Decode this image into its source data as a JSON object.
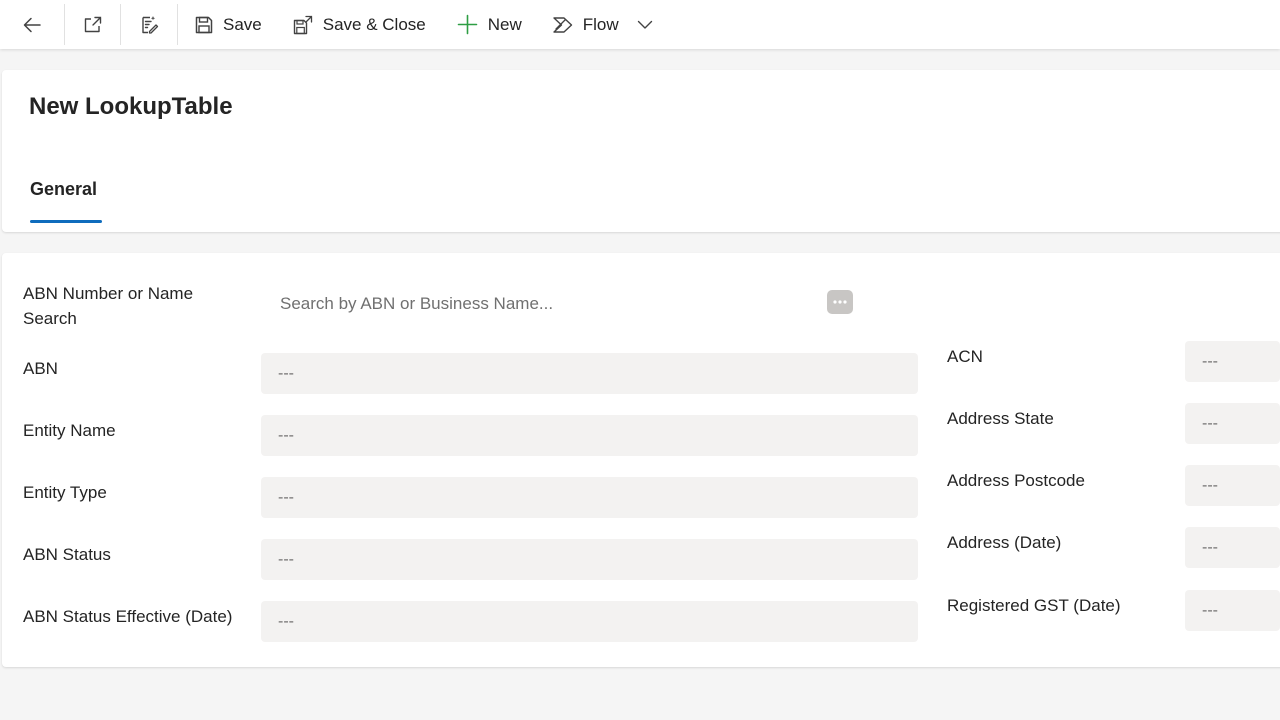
{
  "toolbar": {
    "save_label": "Save",
    "save_close_label": "Save & Close",
    "new_label": "New",
    "flow_label": "Flow"
  },
  "header": {
    "title": "New LookupTable",
    "tabs": [
      {
        "label": "General",
        "selected": true
      }
    ]
  },
  "form": {
    "search": {
      "label": "ABN Number or Name Search",
      "placeholder": "Search by ABN or Business Name..."
    },
    "left_fields": [
      {
        "label": "ABN",
        "value": "---"
      },
      {
        "label": "Entity Name",
        "value": "---"
      },
      {
        "label": "Entity Type",
        "value": "---"
      },
      {
        "label": "ABN Status",
        "value": "---"
      },
      {
        "label": "ABN Status Effective (Date)",
        "value": "---"
      }
    ],
    "right_fields": [
      {
        "label": "ACN",
        "value": "---"
      },
      {
        "label": "Address State",
        "value": "---"
      },
      {
        "label": "Address Postcode",
        "value": "---"
      },
      {
        "label": "Address (Date)",
        "value": "---"
      },
      {
        "label": "Registered GST (Date)",
        "value": "---"
      }
    ]
  },
  "colors": {
    "accent": "#0f6cbd",
    "new_icon": "#2e9e44",
    "field_bg": "#f3f2f1",
    "page_bg": "#f5f5f5"
  },
  "icons": [
    "back-arrow-icon",
    "open-in-new-window-icon",
    "form-edit-icon",
    "save-icon",
    "save-close-icon",
    "plus-icon",
    "flow-icon",
    "chevron-down-icon",
    "more-options-icon"
  ]
}
